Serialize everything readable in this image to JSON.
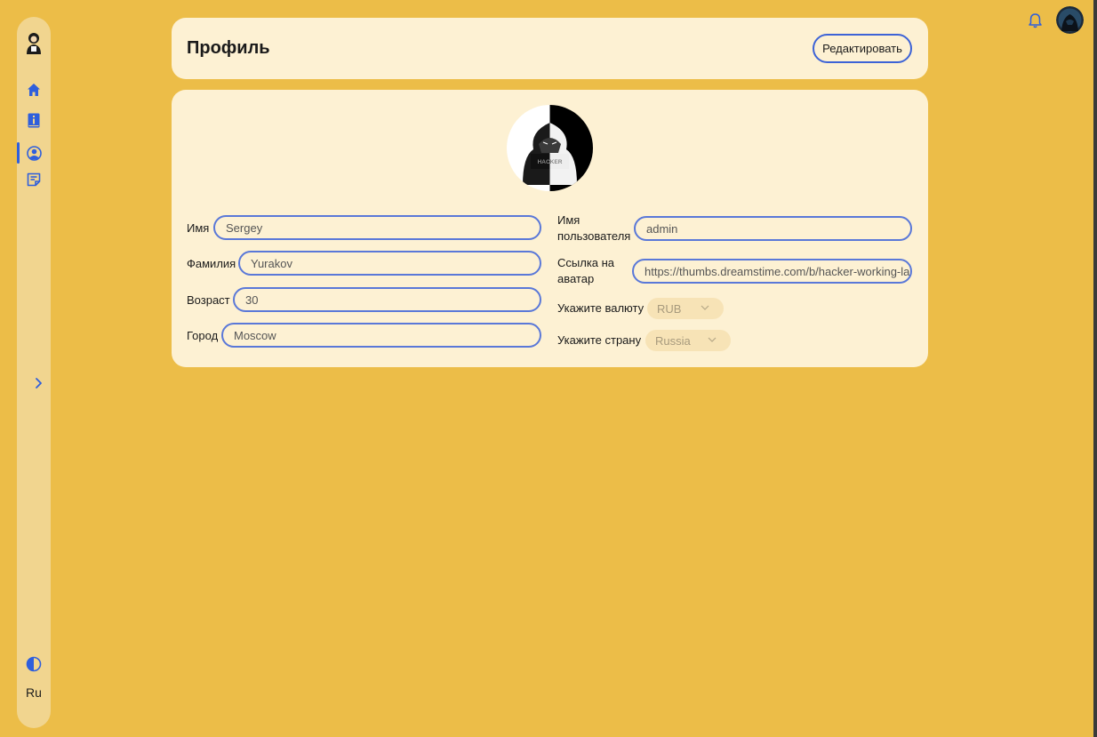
{
  "sidebar": {
    "items": [
      {
        "name": "home",
        "icon": "home-icon"
      },
      {
        "name": "about",
        "icon": "book-info-icon"
      },
      {
        "name": "profile",
        "icon": "user-circle-icon",
        "active": true
      },
      {
        "name": "articles",
        "icon": "notes-icon"
      }
    ],
    "language": "Ru"
  },
  "colors": {
    "accent": "#2f5fdc",
    "background": "#ecbd48",
    "card": "#fdf1d3"
  },
  "header": {
    "title": "Профиль",
    "edit_label": "Редактировать"
  },
  "profile": {
    "first_name_label": "Имя",
    "first_name": "Sergey",
    "last_name_label": "Фамилия",
    "last_name": "Yurakov",
    "age_label": "Возраст",
    "age": "30",
    "city_label": "Город",
    "city": "Moscow",
    "username_label_1": "Имя",
    "username_label_2": "пользователя",
    "username": "admin",
    "avatar_label_1": "Ссылка на",
    "avatar_label_2": "аватар",
    "avatar_url": "https://thumbs.dreamstime.com/b/hacker-working-lap",
    "currency_label": "Укажите валюту",
    "currency": "RUB",
    "country_label": "Укажите страну",
    "country": "Russia",
    "avatar_text": "HACKER"
  }
}
